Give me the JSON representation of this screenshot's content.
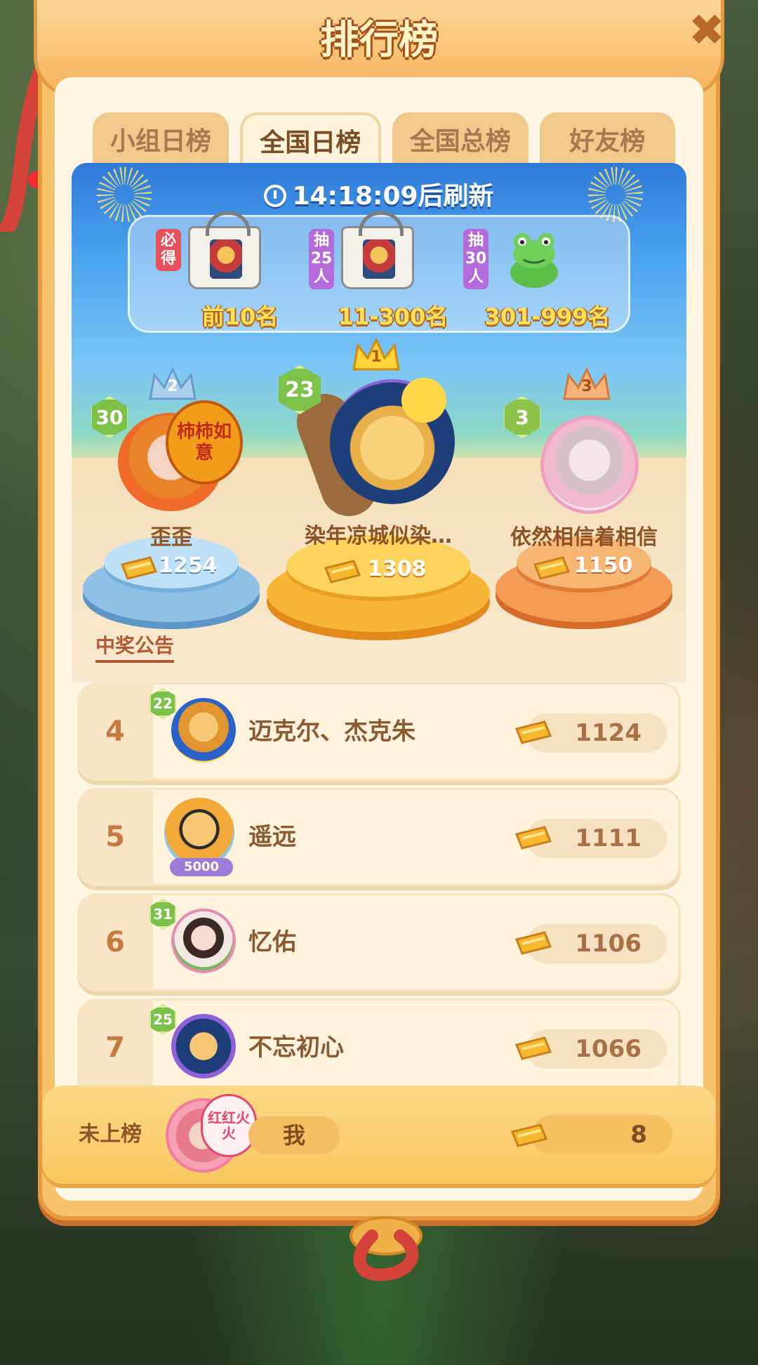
{
  "header": {
    "title": "排行榜"
  },
  "tabs": [
    {
      "label": "小组日榜",
      "active": false
    },
    {
      "label": "全国日榜",
      "active": true
    },
    {
      "label": "全国总榜",
      "active": false
    },
    {
      "label": "好友榜",
      "active": false
    }
  ],
  "timer": {
    "text": "14:18:09后刷新"
  },
  "prizes": [
    {
      "tag": "必得",
      "tag_color": "#e8505b",
      "label": "前10名",
      "item": "bag"
    },
    {
      "tag": "抽25人",
      "tag_color": "#b46ad9",
      "label": "11-300名",
      "item": "bag"
    },
    {
      "tag": "抽30人",
      "tag_color": "#b46ad9",
      "label": "301-999名",
      "item": "frog"
    }
  ],
  "podium": {
    "second": {
      "rank": "2",
      "level": "30",
      "name": "歪歪",
      "score": "1254",
      "badge": "柿柿如意"
    },
    "first": {
      "rank": "1",
      "level": "23",
      "name": "染年凉城似染…",
      "score": "1308"
    },
    "third": {
      "rank": "3",
      "level": "3",
      "name": "依然相信着相信",
      "score": "1150"
    }
  },
  "notice": "中奖公告",
  "list": [
    {
      "rank": "4",
      "level": "22",
      "name": "迈克尔、杰克朱",
      "score": "1124"
    },
    {
      "rank": "5",
      "level": "",
      "name": "遥远",
      "score": "1111",
      "badge": "5000"
    },
    {
      "rank": "6",
      "level": "31",
      "name": "忆佑",
      "score": "1106"
    },
    {
      "rank": "7",
      "level": "25",
      "name": "不忘初心",
      "score": "1066"
    }
  ],
  "mine": {
    "label": "未上榜",
    "name": "我",
    "score": "8",
    "badge": "红红火火"
  },
  "colors": {
    "gold": "#f5b82e",
    "panel": "#f7c36a",
    "accent": "#a5521a"
  }
}
